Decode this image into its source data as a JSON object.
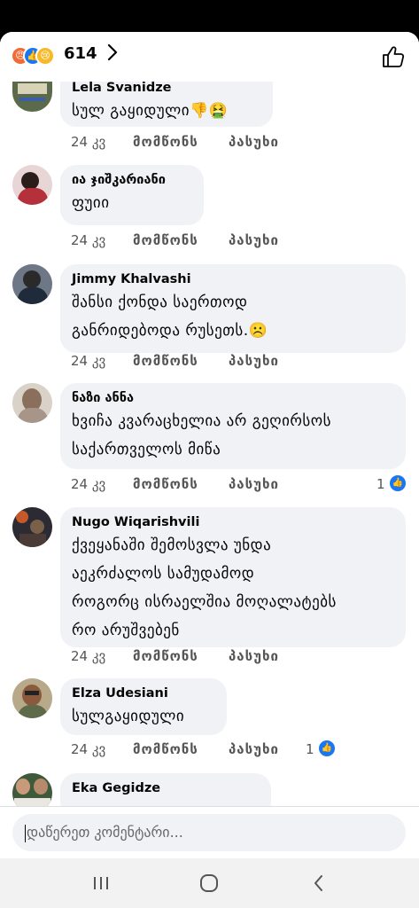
{
  "header": {
    "reaction_icons": [
      "angry-reaction-icon",
      "like-reaction-icon",
      "sad-reaction-icon"
    ],
    "reaction_count": "614",
    "chevron_icon": "chevron-right-icon",
    "thumb_icon": "thumbs-up-icon"
  },
  "actions": {
    "like_label": "მომწონს",
    "reply_label": "პასუხი"
  },
  "comments": [
    {
      "name": "Lela Svanidze",
      "lines": [
        "სულ გაყიდული👎🤮"
      ],
      "time": "24 კვ",
      "reactions": ""
    },
    {
      "name": "ია ჯიშკარიანი",
      "lines": [
        "ფუიი"
      ],
      "time": "24 კვ",
      "reactions": ""
    },
    {
      "name": "Jimmy Khalvashi",
      "lines": [
        "შანსი ქონდა საერთოდ",
        "განრიდებოდა რუსეთს.☹️"
      ],
      "time": "24 კვ",
      "reactions": ""
    },
    {
      "name": "ნაზი ანნა",
      "lines": [
        "ხვიჩა კვარაცხელია არ გეღირსოს",
        "საქართველოს მიწა"
      ],
      "time": "24 კვ",
      "reactions": "1"
    },
    {
      "name": "Nugo Wiqarishvili",
      "lines": [
        "ქვეყანაში შემოსვლა უნდა",
        "აეკრძალოს სამუდამოდ",
        "როგორც ისრაელშია მოღალატებს",
        "რო არუშვებენ"
      ],
      "time": "24 კვ",
      "reactions": ""
    },
    {
      "name": "Elza Udesiani",
      "lines": [
        "სულგაყიდული"
      ],
      "time": "24 კვ",
      "reactions": "1"
    },
    {
      "name": "Eka Gegidze",
      "lines": [],
      "time": "",
      "reactions": ""
    }
  ],
  "composer": {
    "placeholder": "დაწერეთ კომენტარი..."
  },
  "navbar": {
    "icons": [
      "recent-apps-icon",
      "home-icon",
      "back-icon"
    ]
  },
  "colors": {
    "accent": "#1877f2",
    "bubble": "#f0f2f5",
    "meta": "#555555"
  }
}
